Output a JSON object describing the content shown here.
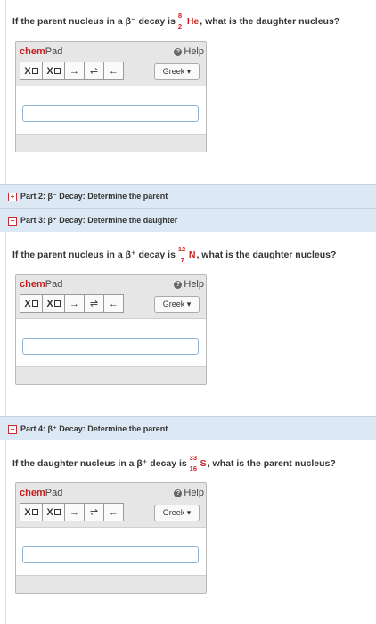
{
  "questions": [
    {
      "before": "If the parent nucleus in a β",
      "charge": "⁻",
      "middle": " decay is ",
      "mass": "8",
      "atomic": "2",
      "symbol": "He",
      "after": ", what is the daughter nucleus?"
    },
    {
      "before": "If the parent nucleus in a β",
      "charge": "⁺",
      "middle": " decay is ",
      "mass": "12",
      "atomic": "7",
      "symbol": "N",
      "after": ", what is the daughter nucleus?"
    },
    {
      "before": "If the daughter nucleus in a β",
      "charge": "⁺",
      "middle": " decay is ",
      "mass": "33",
      "atomic": "16",
      "symbol": "S",
      "after": ", what is the parent nucleus?"
    }
  ],
  "chempad": {
    "chem": "chem",
    "pad": "Pad",
    "help": "Help",
    "help_icon": "?",
    "subscript_label": "X",
    "superscript_label": "X",
    "arrow_right": "→",
    "arrow_equilibrium": "⇌",
    "arrow_left": "←",
    "greek": "Greek ▾"
  },
  "parts": [
    {
      "toggle": "+",
      "label": "Part 2: β⁻ Decay: Determine the parent"
    },
    {
      "toggle": "−",
      "label": "Part 3: β⁺ Decay: Determine the daughter"
    },
    {
      "toggle": "−",
      "label": "Part 4: β⁺ Decay: Determine the parent"
    }
  ],
  "colors": {
    "chem_red": "#c41e1e",
    "part_bg": "#dce8f3",
    "input_border": "#8fb4d8"
  }
}
